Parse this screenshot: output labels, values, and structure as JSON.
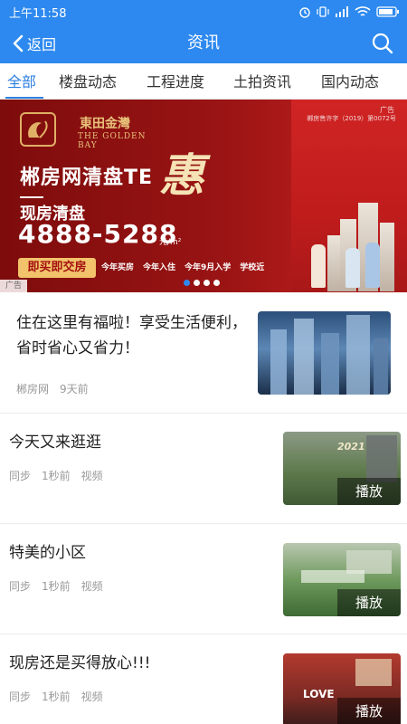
{
  "status_bar": {
    "time": "上午11:58"
  },
  "navbar": {
    "back_label": "返回",
    "title": "资讯"
  },
  "tabs": [
    "全部",
    "楼盘动态",
    "工程进度",
    "土拍资讯",
    "国内动态"
  ],
  "banner": {
    "logo_cn": "東田金灣",
    "logo_en": "THE GOLDEN BAY",
    "ad_corner": "广告",
    "license": "郴房售许字（2019）第0072号",
    "headline": "郴房网清盘TE",
    "hui": "惠",
    "subtitle": "现房清盘",
    "price": "4888-5288",
    "price_unit": "元/m²",
    "pill": "即买即交房",
    "perks": [
      "今年买房",
      "今年入住",
      "今年9月入学",
      "学校近"
    ],
    "ad_tag": "广告",
    "slides_total": 4,
    "active_slide": 1
  },
  "articles": [
    {
      "title": "住在这里有福啦！享受生活便利，省时省心又省力！",
      "source": "郴房网",
      "time": "9天前",
      "kind": ""
    },
    {
      "title": "今天又来逛逛",
      "source": "同步",
      "time": "1秒前",
      "kind": "视频",
      "play_label": "播放",
      "thumb_text": "2021"
    },
    {
      "title": "特美的小区",
      "source": "同步",
      "time": "1秒前",
      "kind": "视频",
      "play_label": "播放"
    },
    {
      "title": "现房还是买得放心!!!",
      "source": "同步",
      "time": "1秒前",
      "kind": "视频",
      "play_label": "播放",
      "thumb_text": "LOVE"
    }
  ],
  "colors": {
    "primary": "#2d89ef",
    "tab_active": "#2d7fe0",
    "banner_red": "#9a1414",
    "pill_gold": "#f2c36b"
  }
}
